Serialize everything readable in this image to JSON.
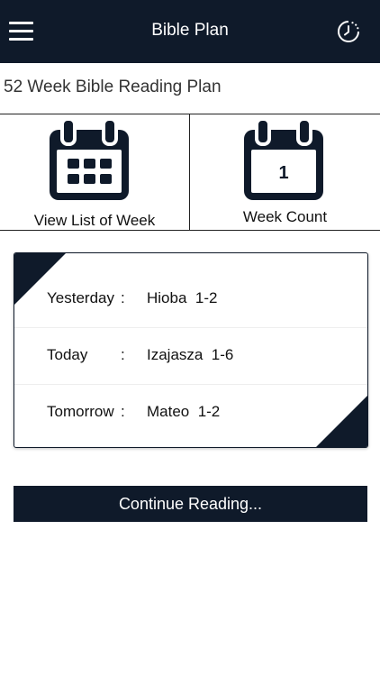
{
  "header": {
    "title": "Bible Plan",
    "menu_icon": "hamburger-menu-icon",
    "history_icon": "history-clock-icon"
  },
  "plan": {
    "title": "52 Week Bible Reading Plan"
  },
  "tiles": {
    "view_list": {
      "label": "View List of Week",
      "icon": "calendar-grid-icon"
    },
    "week_count": {
      "label": "Week Count",
      "icon": "calendar-number-icon",
      "number": "1"
    }
  },
  "readings": [
    {
      "day": "Yesterday",
      "colon": ":",
      "passage": "Hioba  1-2"
    },
    {
      "day": "Today",
      "colon": ":",
      "passage": "Izajasza  1-6"
    },
    {
      "day": "Tomorrow",
      "colon": ":",
      "passage": "Mateo  1-2"
    }
  ],
  "actions": {
    "continue_label": "Continue Reading..."
  },
  "colors": {
    "primary": "#0f1a2a",
    "background": "#ffffff"
  }
}
